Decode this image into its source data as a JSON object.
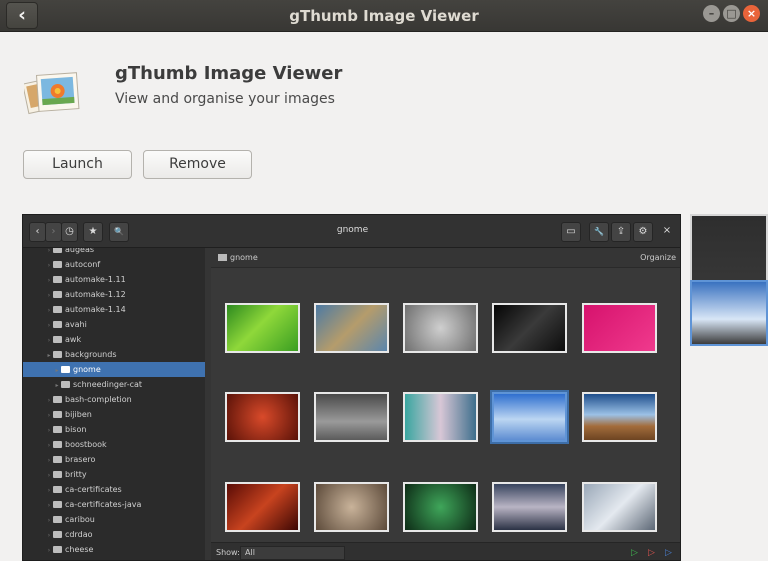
{
  "window": {
    "title": "gThumb Image Viewer",
    "back_icon": "back-chevron-icon",
    "minimize": "–",
    "maximize": "□",
    "close": "×"
  },
  "app": {
    "name": "gThumb Image Viewer",
    "description": "View and organise your images"
  },
  "actions": {
    "launch": "Launch",
    "remove": "Remove"
  },
  "screenshot": {
    "title": "gnome",
    "path": "gnome",
    "organize": "Organize",
    "show_label": "Show:",
    "show_value": "All",
    "toolbar": {
      "back": "‹",
      "forward": "›",
      "history": "◷",
      "bookmark": "★",
      "search": "🔍",
      "view": "▭",
      "tools": "🔧",
      "share": "⇪",
      "settings": "⚙",
      "close": "×"
    },
    "tree": [
      {
        "label": "augeas",
        "selected": false,
        "indent": 0
      },
      {
        "label": "autoconf",
        "selected": false,
        "indent": 0
      },
      {
        "label": "automake-1.11",
        "selected": false,
        "indent": 0
      },
      {
        "label": "automake-1.12",
        "selected": false,
        "indent": 0
      },
      {
        "label": "automake-1.14",
        "selected": false,
        "indent": 0
      },
      {
        "label": "avahi",
        "selected": false,
        "indent": 0
      },
      {
        "label": "awk",
        "selected": false,
        "indent": 0
      },
      {
        "label": "backgrounds",
        "selected": false,
        "indent": 0
      },
      {
        "label": "gnome",
        "selected": true,
        "indent": 1
      },
      {
        "label": "schneedinger-cat",
        "selected": false,
        "indent": 1
      },
      {
        "label": "bash-completion",
        "selected": false,
        "indent": 0
      },
      {
        "label": "bijiben",
        "selected": false,
        "indent": 0
      },
      {
        "label": "bison",
        "selected": false,
        "indent": 0
      },
      {
        "label": "boostbook",
        "selected": false,
        "indent": 0
      },
      {
        "label": "brasero",
        "selected": false,
        "indent": 0
      },
      {
        "label": "britty",
        "selected": false,
        "indent": 0
      },
      {
        "label": "ca-certificates",
        "selected": false,
        "indent": 0
      },
      {
        "label": "ca-certificates-java",
        "selected": false,
        "indent": 0
      },
      {
        "label": "caribou",
        "selected": false,
        "indent": 0
      },
      {
        "label": "cdrdao",
        "selected": false,
        "indent": 0
      },
      {
        "label": "cheese",
        "selected": false,
        "indent": 0
      }
    ],
    "thumbnails": [
      {
        "kind": "green-leaf",
        "bg": "linear-gradient(135deg,#2d8a1f,#8fd83a 45%,#3a9e22)",
        "selected": false
      },
      {
        "kind": "dandelion",
        "bg": "linear-gradient(135deg,#4d7aa3,#b59c6b 50%,#5b86ad)",
        "selected": false
      },
      {
        "kind": "water-drops",
        "bg": "radial-gradient(circle,#cfcfcf,#6f6f6f)",
        "selected": false
      },
      {
        "kind": "dark-leaves",
        "bg": "linear-gradient(135deg,#050505,#3a3a3a 50%,#0c0c0c)",
        "selected": false
      },
      {
        "kind": "pink",
        "bg": "linear-gradient(135deg,#d6126d,#f03a8d)",
        "selected": false
      },
      {
        "kind": "red-berries",
        "bg": "radial-gradient(circle,#d94a2a,#5a1208)",
        "selected": false
      },
      {
        "kind": "stones",
        "bg": "linear-gradient(180deg,#4a4a4a,#9a9a9a 60%,#5b5b5b)",
        "selected": false
      },
      {
        "kind": "aurora",
        "bg": "linear-gradient(90deg,#3aa6a0,#d8c7d6 50%,#3e6f8c)",
        "selected": false
      },
      {
        "kind": "blue-sky",
        "bg": "linear-gradient(180deg,#2f6fcf,#bcd6f2 55%,#5e8dd2)",
        "selected": true
      },
      {
        "kind": "desert-road",
        "bg": "linear-gradient(180deg,#1e4e8c,#9cc1e6 45%,#a36c3b 70%,#6d4422)",
        "selected": false
      },
      {
        "kind": "red-canyon",
        "bg": "linear-gradient(135deg,#5a0c06,#c8431f 50%,#3d0704)",
        "selected": false
      },
      {
        "kind": "pebbles",
        "bg": "radial-gradient(circle,#c9b39a,#5c4a3a)",
        "selected": false
      },
      {
        "kind": "green-glow",
        "bg": "radial-gradient(circle,#3fa65a,#0d2b16)",
        "selected": false
      },
      {
        "kind": "dusk-beach",
        "bg": "linear-gradient(180deg,#38445e,#b9b4c4 50%,#2b3245)",
        "selected": false
      },
      {
        "kind": "frost-grass",
        "bg": "linear-gradient(135deg,#9aa8b8,#e4e9ef 50%,#5c6775)",
        "selected": false
      }
    ]
  },
  "strip": [
    {
      "kind": "gthumb-screenshot-1",
      "bg": "linear-gradient(180deg,#2e2e2e,#3e3e3e)",
      "selected": false
    },
    {
      "kind": "gthumb-screenshot-2",
      "bg": "linear-gradient(180deg,#3a72c0,#d8e6f6 60%,#3c3c3c)",
      "selected": true
    }
  ]
}
